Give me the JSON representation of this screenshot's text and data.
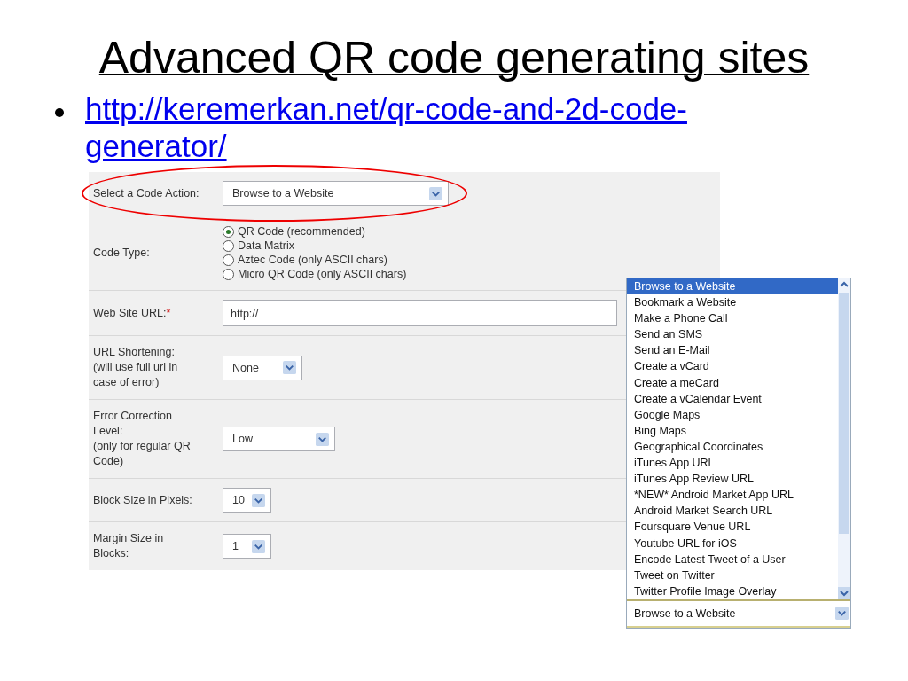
{
  "title": "Advanced QR code generating sites",
  "bullet": {
    "link": "http://keremerkan.net/qr-code-and-2d-code-generator/"
  },
  "form": {
    "rows": [
      {
        "kind": "select",
        "label": [
          "Select a Code Action:"
        ],
        "value": "Browse to a Website",
        "highlighted": true
      },
      {
        "kind": "radio",
        "label": [
          "Code Type:"
        ],
        "options": [
          {
            "label": "QR Code (recommended)",
            "selected": true
          },
          {
            "label": "Data Matrix",
            "selected": false
          },
          {
            "label": "Aztec Code (only ASCII chars)",
            "selected": false
          },
          {
            "label": "Micro QR Code (only ASCII chars)",
            "selected": false
          }
        ]
      },
      {
        "kind": "text",
        "label": [
          "Web Site URL:"
        ],
        "required_mark": "*",
        "value": "http://"
      },
      {
        "kind": "select",
        "label": [
          "URL Shortening:",
          "(will use full url in",
          "case of error)"
        ],
        "value": "None"
      },
      {
        "kind": "select",
        "label": [
          "Error Correction",
          "Level:",
          "(only for regular QR",
          "Code)"
        ],
        "value": "Low"
      },
      {
        "kind": "select",
        "label": [
          "Block Size in Pixels:"
        ],
        "value": "10"
      },
      {
        "kind": "select",
        "label": [
          "Margin Size in",
          "Blocks:"
        ],
        "value": "1"
      }
    ]
  },
  "dropdown": {
    "options": [
      {
        "label": "Browse to a Website",
        "selected": true
      },
      {
        "label": "Bookmark a Website",
        "selected": false
      },
      {
        "label": "Make a Phone Call",
        "selected": false
      },
      {
        "label": "Send an SMS",
        "selected": false
      },
      {
        "label": "Send an E-Mail",
        "selected": false
      },
      {
        "label": "Create a vCard",
        "selected": false
      },
      {
        "label": "Create a meCard",
        "selected": false
      },
      {
        "label": "Create a vCalendar Event",
        "selected": false
      },
      {
        "label": "Google Maps",
        "selected": false
      },
      {
        "label": "Bing Maps",
        "selected": false
      },
      {
        "label": "Geographical Coordinates",
        "selected": false
      },
      {
        "label": "iTunes App URL",
        "selected": false
      },
      {
        "label": "iTunes App Review URL",
        "selected": false
      },
      {
        "label": "*NEW* Android Market App URL",
        "selected": false
      },
      {
        "label": "Android Market Search URL",
        "selected": false
      },
      {
        "label": "Foursquare Venue URL",
        "selected": false
      },
      {
        "label": "Youtube URL for iOS",
        "selected": false
      },
      {
        "label": "Encode Latest Tweet of a User",
        "selected": false
      },
      {
        "label": "Tweet on Twitter",
        "selected": false
      },
      {
        "label": "Twitter Profile Image Overlay",
        "selected": false
      }
    ],
    "value": "Browse to a Website"
  }
}
